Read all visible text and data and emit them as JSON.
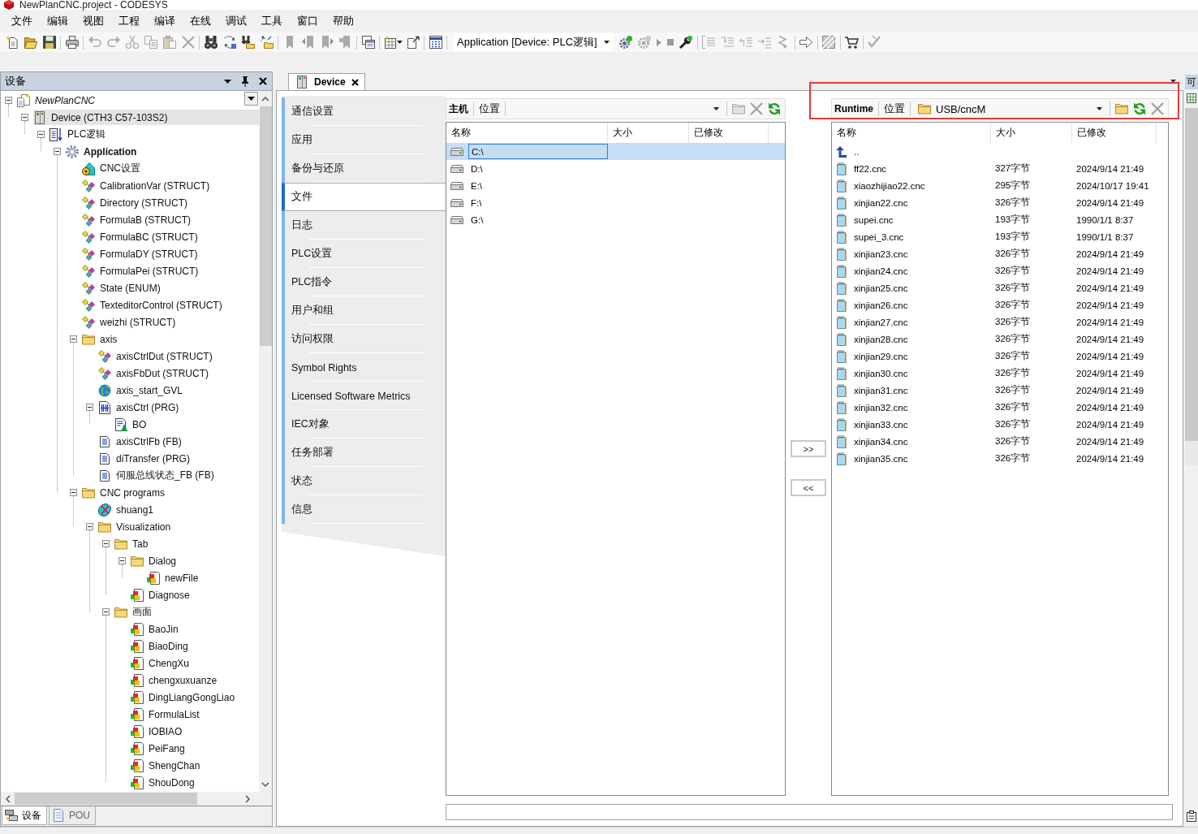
{
  "window": {
    "title": "NewPlanCNC.project - CODESYS"
  },
  "menu": [
    "文件",
    "编辑",
    "视图",
    "工程",
    "编译",
    "在线",
    "调试",
    "工具",
    "窗口",
    "帮助"
  ],
  "toolbar": {
    "application_selector": "Application [Device: PLC逻辑]"
  },
  "devices_panel": {
    "title": "设备",
    "tree": [
      {
        "label": "NewPlanCNC",
        "kind": "project",
        "selected": false,
        "expanded": true,
        "children": [
          {
            "label": "Device (CTH3 C57-103S2)",
            "kind": "device",
            "selected": true,
            "expanded": true,
            "children": [
              {
                "label": "PLC逻辑",
                "kind": "plc",
                "selected": false,
                "expanded": true,
                "children": [
                  {
                    "label": "Application",
                    "kind": "application",
                    "selected": false,
                    "expanded": true,
                    "children": [
                      {
                        "label": "CNC设置",
                        "kind": "cnc_settings",
                        "selected": false
                      },
                      {
                        "label": "CalibrationVar (STRUCT)",
                        "kind": "dut",
                        "selected": false
                      },
                      {
                        "label": "Directory (STRUCT)",
                        "kind": "dut",
                        "selected": false
                      },
                      {
                        "label": "FormulaB (STRUCT)",
                        "kind": "dut",
                        "selected": false
                      },
                      {
                        "label": "FormulaBC (STRUCT)",
                        "kind": "dut",
                        "selected": false
                      },
                      {
                        "label": "FormulaDY (STRUCT)",
                        "kind": "dut",
                        "selected": false
                      },
                      {
                        "label": "FormulaPei (STRUCT)",
                        "kind": "dut",
                        "selected": false
                      },
                      {
                        "label": "State (ENUM)",
                        "kind": "dut",
                        "selected": false
                      },
                      {
                        "label": "TexteditorControl (STRUCT)",
                        "kind": "dut",
                        "selected": false
                      },
                      {
                        "label": "weizhi (STRUCT)",
                        "kind": "dut",
                        "selected": false
                      },
                      {
                        "label": "axis",
                        "kind": "folder",
                        "selected": false,
                        "expanded": true,
                        "children": [
                          {
                            "label": "axisCtrlDut (STRUCT)",
                            "kind": "dut",
                            "selected": false
                          },
                          {
                            "label": "axisFbDut (STRUCT)",
                            "kind": "dut",
                            "selected": false
                          },
                          {
                            "label": "axis_start_GVL",
                            "kind": "gvl",
                            "selected": false
                          },
                          {
                            "label": "axisCtrl (PRG)",
                            "kind": "prg_ladder",
                            "selected": false,
                            "expanded": true,
                            "children": [
                              {
                                "label": "BO",
                                "kind": "action",
                                "selected": false
                              }
                            ]
                          },
                          {
                            "label": "axisCtrlFb (FB)",
                            "kind": "pou",
                            "selected": false
                          },
                          {
                            "label": "diTransfer (PRG)",
                            "kind": "pou",
                            "selected": false
                          },
                          {
                            "label": "伺服总线状态_FB (FB)",
                            "kind": "pou",
                            "selected": false
                          }
                        ]
                      },
                      {
                        "label": "CNC programs",
                        "kind": "folder",
                        "selected": false,
                        "expanded": true,
                        "children": [
                          {
                            "label": "shuang1",
                            "kind": "cnc_program",
                            "selected": false
                          },
                          {
                            "label": "Visualization",
                            "kind": "folder",
                            "selected": false,
                            "expanded": true,
                            "children": [
                              {
                                "label": "Tab",
                                "kind": "folder",
                                "selected": false,
                                "expanded": true,
                                "children": [
                                  {
                                    "label": "Dialog",
                                    "kind": "folder",
                                    "selected": false,
                                    "expanded": true,
                                    "children": [
                                      {
                                        "label": "newFile",
                                        "kind": "visu",
                                        "selected": false
                                      }
                                    ]
                                  },
                                  {
                                    "label": "Diagnose",
                                    "kind": "visu",
                                    "selected": false
                                  }
                                ]
                              },
                              {
                                "label": "画面",
                                "kind": "folder",
                                "selected": false,
                                "expanded": true,
                                "children": [
                                  {
                                    "label": "BaoJin",
                                    "kind": "visu",
                                    "selected": false
                                  },
                                  {
                                    "label": "BiaoDing",
                                    "kind": "visu",
                                    "selected": false
                                  },
                                  {
                                    "label": "ChengXu",
                                    "kind": "visu",
                                    "selected": false
                                  },
                                  {
                                    "label": "chengxuxuanze",
                                    "kind": "visu",
                                    "selected": false
                                  },
                                  {
                                    "label": "DingLiangGongLiao",
                                    "kind": "visu",
                                    "selected": false
                                  },
                                  {
                                    "label": "FormulaList",
                                    "kind": "visu",
                                    "selected": false
                                  },
                                  {
                                    "label": "IOBIAO",
                                    "kind": "visu",
                                    "selected": false
                                  },
                                  {
                                    "label": "PeiFang",
                                    "kind": "visu",
                                    "selected": false
                                  },
                                  {
                                    "label": "ShengChan",
                                    "kind": "visu",
                                    "selected": false
                                  },
                                  {
                                    "label": "ShouDong",
                                    "kind": "visu",
                                    "selected": false
                                  }
                                ]
                              }
                            ]
                          }
                        ]
                      }
                    ]
                  }
                ]
              }
            ]
          }
        ]
      }
    ],
    "bottom_tabs": [
      {
        "label": "设备",
        "selected": true
      },
      {
        "label": "POU",
        "selected": false
      }
    ]
  },
  "editor_tabs": [
    {
      "label": "Device",
      "selected": true
    }
  ],
  "device_editor": {
    "nav": [
      {
        "label": "通信设置",
        "selected": false
      },
      {
        "label": "应用",
        "selected": false
      },
      {
        "label": "备份与还原",
        "selected": false
      },
      {
        "label": "文件",
        "selected": true
      },
      {
        "label": "日志",
        "selected": false
      },
      {
        "label": "PLC设置",
        "selected": false
      },
      {
        "label": "PLC指令",
        "selected": false
      },
      {
        "label": "用户和组",
        "selected": false
      },
      {
        "label": "访问权限",
        "selected": false
      },
      {
        "label": "Symbol Rights",
        "selected": false
      },
      {
        "label": "Licensed Software Metrics",
        "selected": false
      },
      {
        "label": "IEC对象",
        "selected": false
      },
      {
        "label": "任务部署",
        "selected": false
      },
      {
        "label": "状态",
        "selected": false
      },
      {
        "label": "信息",
        "selected": false
      }
    ],
    "host_browser": {
      "title": "主机",
      "location_label": "位置",
      "columns": [
        "名称",
        "大小",
        "已修改"
      ],
      "rows": [
        {
          "name": "C:\\",
          "selected": true
        },
        {
          "name": "D:\\",
          "selected": false
        },
        {
          "name": "E:\\",
          "selected": false
        },
        {
          "name": "F:\\",
          "selected": false
        },
        {
          "name": "G:\\",
          "selected": false
        }
      ]
    },
    "transfer_buttons": [
      ">>",
      "<<"
    ],
    "runtime_browser": {
      "title": "Runtime",
      "location_label": "位置",
      "location": "USB/cncM",
      "highlighted": true,
      "columns": [
        "名称",
        "大小",
        "已修改"
      ],
      "rows": [
        {
          "kind": "parent",
          "name": "..",
          "selected": false
        },
        {
          "kind": "file",
          "name": "ff22.cnc",
          "size": "327字节",
          "modified": "2024/9/14 21:49",
          "selected": false
        },
        {
          "kind": "file",
          "name": "xiaozhijiao22.cnc",
          "size": "295字节",
          "modified": "2024/10/17 19:41",
          "selected": false
        },
        {
          "kind": "file",
          "name": "xinjian22.cnc",
          "size": "326字节",
          "modified": "2024/9/14 21:49",
          "selected": false
        },
        {
          "kind": "file",
          "name": "supei.cnc",
          "size": "193字节",
          "modified": "1990/1/1 8:37",
          "selected": false
        },
        {
          "kind": "file",
          "name": "supei_3.cnc",
          "size": "193字节",
          "modified": "1990/1/1 8:37",
          "selected": false
        },
        {
          "kind": "file",
          "name": "xinjian23.cnc",
          "size": "326字节",
          "modified": "2024/9/14 21:49",
          "selected": false
        },
        {
          "kind": "file",
          "name": "xinjian24.cnc",
          "size": "326字节",
          "modified": "2024/9/14 21:49",
          "selected": false
        },
        {
          "kind": "file",
          "name": "xinjian25.cnc",
          "size": "326字节",
          "modified": "2024/9/14 21:49",
          "selected": false
        },
        {
          "kind": "file",
          "name": "xinjian26.cnc",
          "size": "326字节",
          "modified": "2024/9/14 21:49",
          "selected": false
        },
        {
          "kind": "file",
          "name": "xinjian27.cnc",
          "size": "326字节",
          "modified": "2024/9/14 21:49",
          "selected": false
        },
        {
          "kind": "file",
          "name": "xinjian28.cnc",
          "size": "326字节",
          "modified": "2024/9/14 21:49",
          "selected": false
        },
        {
          "kind": "file",
          "name": "xinjian29.cnc",
          "size": "326字节",
          "modified": "2024/9/14 21:49",
          "selected": false
        },
        {
          "kind": "file",
          "name": "xinjian30.cnc",
          "size": "326字节",
          "modified": "2024/9/14 21:49",
          "selected": false
        },
        {
          "kind": "file",
          "name": "xinjian31.cnc",
          "size": "326字节",
          "modified": "2024/9/14 21:49",
          "selected": false
        },
        {
          "kind": "file",
          "name": "xinjian32.cnc",
          "size": "326字节",
          "modified": "2024/9/14 21:49",
          "selected": false
        },
        {
          "kind": "file",
          "name": "xinjian33.cnc",
          "size": "326字节",
          "modified": "2024/9/14 21:49",
          "selected": false
        },
        {
          "kind": "file",
          "name": "xinjian34.cnc",
          "size": "326字节",
          "modified": "2024/9/14 21:49",
          "selected": false
        },
        {
          "kind": "file",
          "name": "xinjian35.cnc",
          "size": "326字节",
          "modified": "2024/9/14 21:49",
          "selected": false
        }
      ]
    }
  },
  "side_panel": {
    "title": "可"
  }
}
